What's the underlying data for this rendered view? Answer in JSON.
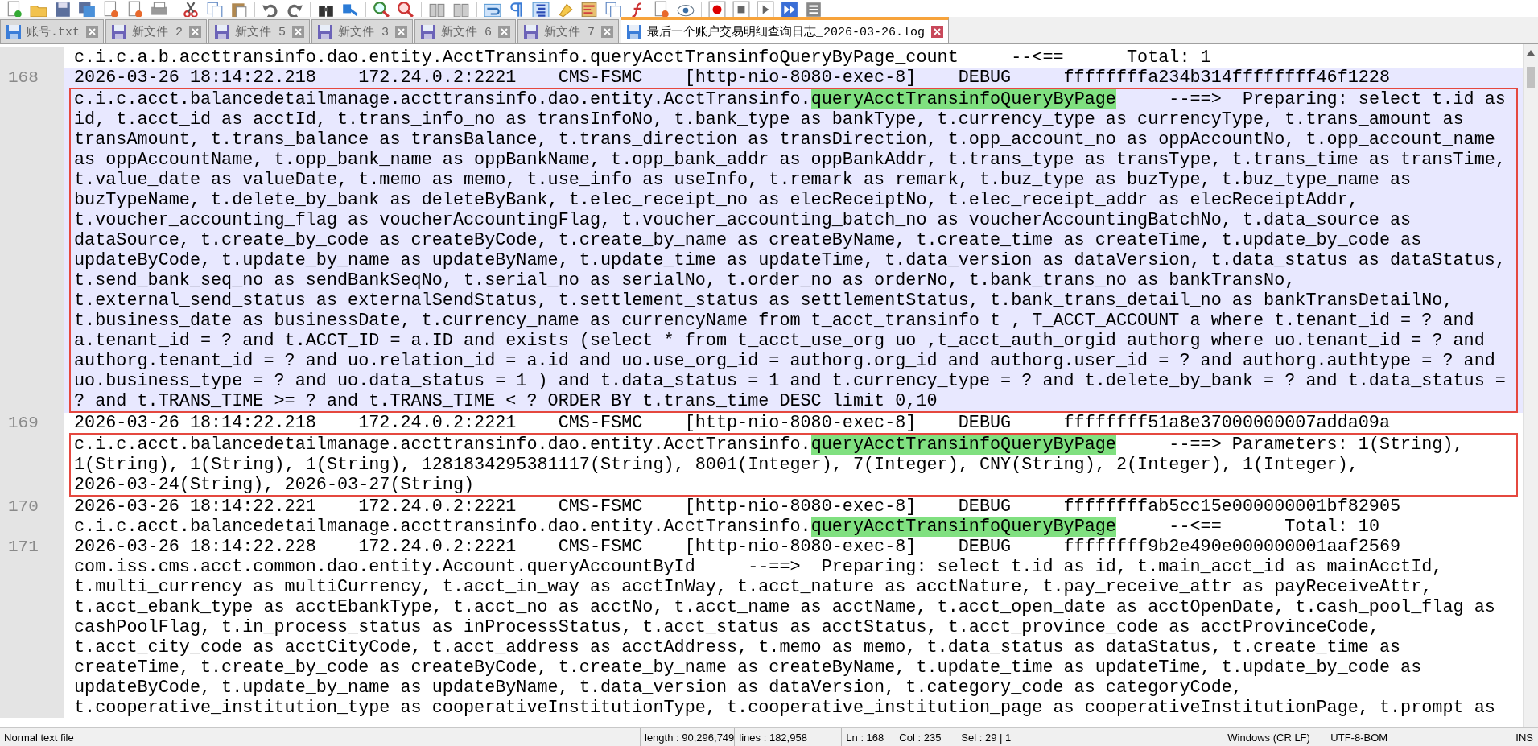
{
  "tabs": [
    {
      "label": "账号.txt",
      "selected": false,
      "saved": true
    },
    {
      "label": "新文件 2",
      "selected": false,
      "saved": false
    },
    {
      "label": "新文件 5",
      "selected": false,
      "saved": false
    },
    {
      "label": "新文件 3",
      "selected": false,
      "saved": false
    },
    {
      "label": "新文件 6",
      "selected": false,
      "saved": false
    },
    {
      "label": "新文件 7",
      "selected": false,
      "saved": false
    },
    {
      "label": "最后一个账户交易明细查询日志_2026-03-26.log",
      "selected": true,
      "saved": true
    }
  ],
  "editor": {
    "lines": [
      {
        "current": false,
        "blocks": [
          {
            "boxed": false,
            "rows": [
              [
                {
                  "text": "c.i.c.a.b.accttransinfo.dao.entity.AcctTransinfo.queryAcctTransinfoQueryByPage_count     --<==      Total: 1",
                  "highlighted": false
                }
              ]
            ]
          }
        ]
      },
      {
        "number": "168",
        "current": true,
        "blocks": [
          {
            "boxed": false,
            "rows": [
              [
                {
                  "text": "2026-03-26 18:14:22.218    172.24.0.2:2221    CMS-FSMC    [http-nio-8080-exec-8]    DEBUG     ffffffffa234b314ffffffff46f1228",
                  "highlighted": false
                }
              ]
            ]
          },
          {
            "boxed": true,
            "rows": [
              [
                {
                  "text": "c.i.c.acct.balancedetailmanage.accttransinfo.dao.entity.AcctTransinfo.",
                  "highlighted": false
                },
                {
                  "text": "queryAcctTransinfoQueryByPage",
                  "highlighted": true
                },
                {
                  "text": "     --==>  Preparing: select t.id as",
                  "highlighted": false
                }
              ],
              [
                {
                  "text": "id, t.acct_id as acctId, t.trans_info_no as transInfoNo, t.bank_type as bankType, t.currency_type as currencyType, t.trans_amount as",
                  "highlighted": false
                }
              ],
              [
                {
                  "text": "transAmount, t.trans_balance as transBalance, t.trans_direction as transDirection, t.opp_account_no as oppAccountNo, t.opp_account_name",
                  "highlighted": false
                }
              ],
              [
                {
                  "text": "as oppAccountName, t.opp_bank_name as oppBankName, t.opp_bank_addr as oppBankAddr, t.trans_type as transType, t.trans_time as transTime,",
                  "highlighted": false
                }
              ],
              [
                {
                  "text": "t.value_date as valueDate, t.memo as memo, t.use_info as useInfo, t.remark as remark, t.buz_type as buzType, t.buz_type_name as",
                  "highlighted": false
                }
              ],
              [
                {
                  "text": "buzTypeName, t.delete_by_bank as deleteByBank, t.elec_receipt_no as elecReceiptNo, t.elec_receipt_addr as elecReceiptAddr,",
                  "highlighted": false
                }
              ],
              [
                {
                  "text": "t.voucher_accounting_flag as voucherAccountingFlag, t.voucher_accounting_batch_no as voucherAccountingBatchNo, t.data_source as",
                  "highlighted": false
                }
              ],
              [
                {
                  "text": "dataSource, t.create_by_code as createByCode, t.create_by_name as createByName, t.create_time as createTime, t.update_by_code as",
                  "highlighted": false
                }
              ],
              [
                {
                  "text": "updateByCode, t.update_by_name as updateByName, t.update_time as updateTime, t.data_version as dataVersion, t.data_status as dataStatus,",
                  "highlighted": false
                }
              ],
              [
                {
                  "text": "t.send_bank_seq_no as sendBankSeqNo, t.serial_no as serialNo, t.order_no as orderNo, t.bank_trans_no as bankTransNo,",
                  "highlighted": false
                }
              ],
              [
                {
                  "text": "t.external_send_status as externalSendStatus, t.settlement_status as settlementStatus, t.bank_trans_detail_no as bankTransDetailNo,",
                  "highlighted": false
                }
              ],
              [
                {
                  "text": "t.business_date as businessDate, t.currency_name as currencyName from t_acct_transinfo t , T_ACCT_ACCOUNT a where t.tenant_id = ? and",
                  "highlighted": false
                }
              ],
              [
                {
                  "text": "a.tenant_id = ? and t.ACCT_ID = a.ID and exists (select * from t_acct_use_org uo ,t_acct_auth_orgid authorg where uo.tenant_id = ? and",
                  "highlighted": false
                }
              ],
              [
                {
                  "text": "authorg.tenant_id = ? and uo.relation_id = a.id and uo.use_org_id = authorg.org_id and authorg.user_id = ? and authorg.authtype = ? and",
                  "highlighted": false
                }
              ],
              [
                {
                  "text": "uo.business_type = ? and uo.data_status = 1 ) and t.data_status = 1 and t.currency_type = ? and t.delete_by_bank = ? and t.data_status =",
                  "highlighted": false
                }
              ],
              [
                {
                  "text": "? and t.TRANS_TIME >= ? and t.TRANS_TIME < ? ORDER BY t.trans_time DESC limit 0,10",
                  "highlighted": false
                }
              ]
            ]
          }
        ]
      },
      {
        "number": "169",
        "current": false,
        "blocks": [
          {
            "boxed": false,
            "rows": [
              [
                {
                  "text": "2026-03-26 18:14:22.218    172.24.0.2:2221    CMS-FSMC    [http-nio-8080-exec-8]    DEBUG     ffffffff51a8e37000000007adda09a",
                  "highlighted": false
                }
              ]
            ]
          },
          {
            "boxed": true,
            "rows": [
              [
                {
                  "text": "c.i.c.acct.balancedetailmanage.accttransinfo.dao.entity.AcctTransinfo.",
                  "highlighted": false
                },
                {
                  "text": "queryAcctTransinfoQueryByPage",
                  "highlighted": true
                },
                {
                  "text": "     --==> Parameters: 1(String),",
                  "highlighted": false
                }
              ],
              [
                {
                  "text": "1(String), 1(String), 1(String), 1281834295381117(String), 8001(Integer), 7(Integer), CNY(String), 2(Integer), 1(Integer),",
                  "highlighted": false
                }
              ],
              [
                {
                  "text": "2026-03-24(String), 2026-03-27(String)",
                  "highlighted": false
                }
              ]
            ]
          }
        ]
      },
      {
        "number": "170",
        "current": false,
        "blocks": [
          {
            "boxed": false,
            "rows": [
              [
                {
                  "text": "2026-03-26 18:14:22.221    172.24.0.2:2221    CMS-FSMC    [http-nio-8080-exec-8]    DEBUG     ffffffffab5cc15e000000001bf82905",
                  "highlighted": false
                }
              ],
              [
                {
                  "text": "c.i.c.acct.balancedetailmanage.accttransinfo.dao.entity.AcctTransinfo.",
                  "highlighted": false
                },
                {
                  "text": "queryAcctTransinfoQueryByPage",
                  "highlighted": true
                },
                {
                  "text": "     --<==      Total: 10",
                  "highlighted": false
                }
              ]
            ]
          }
        ]
      },
      {
        "number": "171",
        "current": false,
        "blocks": [
          {
            "boxed": false,
            "rows": [
              [
                {
                  "text": "2026-03-26 18:14:22.228    172.24.0.2:2221    CMS-FSMC    [http-nio-8080-exec-8]    DEBUG     ffffffff9b2e490e000000001aaf2569",
                  "highlighted": false
                }
              ],
              [
                {
                  "text": "com.iss.cms.acct.common.dao.entity.Account.queryAccountById     --==>  Preparing: select t.id as id, t.main_acct_id as mainAcctId,",
                  "highlighted": false
                }
              ],
              [
                {
                  "text": "t.multi_currency as multiCurrency, t.acct_in_way as acctInWay, t.acct_nature as acctNature, t.pay_receive_attr as payReceiveAttr,",
                  "highlighted": false
                }
              ],
              [
                {
                  "text": "t.acct_ebank_type as acctEbankType, t.acct_no as acctNo, t.acct_name as acctName, t.acct_open_date as acctOpenDate, t.cash_pool_flag as",
                  "highlighted": false
                }
              ],
              [
                {
                  "text": "cashPoolFlag, t.in_process_status as inProcessStatus, t.acct_status as acctStatus, t.acct_province_code as acctProvinceCode,",
                  "highlighted": false
                }
              ],
              [
                {
                  "text": "t.acct_city_code as acctCityCode, t.acct_address as acctAddress, t.memo as memo, t.data_status as dataStatus, t.create_time as",
                  "highlighted": false
                }
              ],
              [
                {
                  "text": "createTime, t.create_by_code as createByCode, t.create_by_name as createByName, t.update_time as updateTime, t.update_by_code as",
                  "highlighted": false
                }
              ],
              [
                {
                  "text": "updateByCode, t.update_by_name as updateByName, t.data_version as dataVersion, t.category_code as categoryCode,",
                  "highlighted": false
                }
              ],
              [
                {
                  "text": "t.cooperative_institution_type as cooperativeInstitutionType, t.cooperative_institution_page as cooperativeInstitutionPage, t.prompt as",
                  "highlighted": false
                }
              ]
            ]
          }
        ]
      }
    ]
  },
  "status_bar": [
    "Normal text file",
    "length : 90,296,749",
    "lines : 182,958",
    "Ln : 168",
    "Col : 235",
    "Sel : 29 | 1",
    "Windows (CR LF)",
    "UTF-8-BOM",
    "INS"
  ]
}
